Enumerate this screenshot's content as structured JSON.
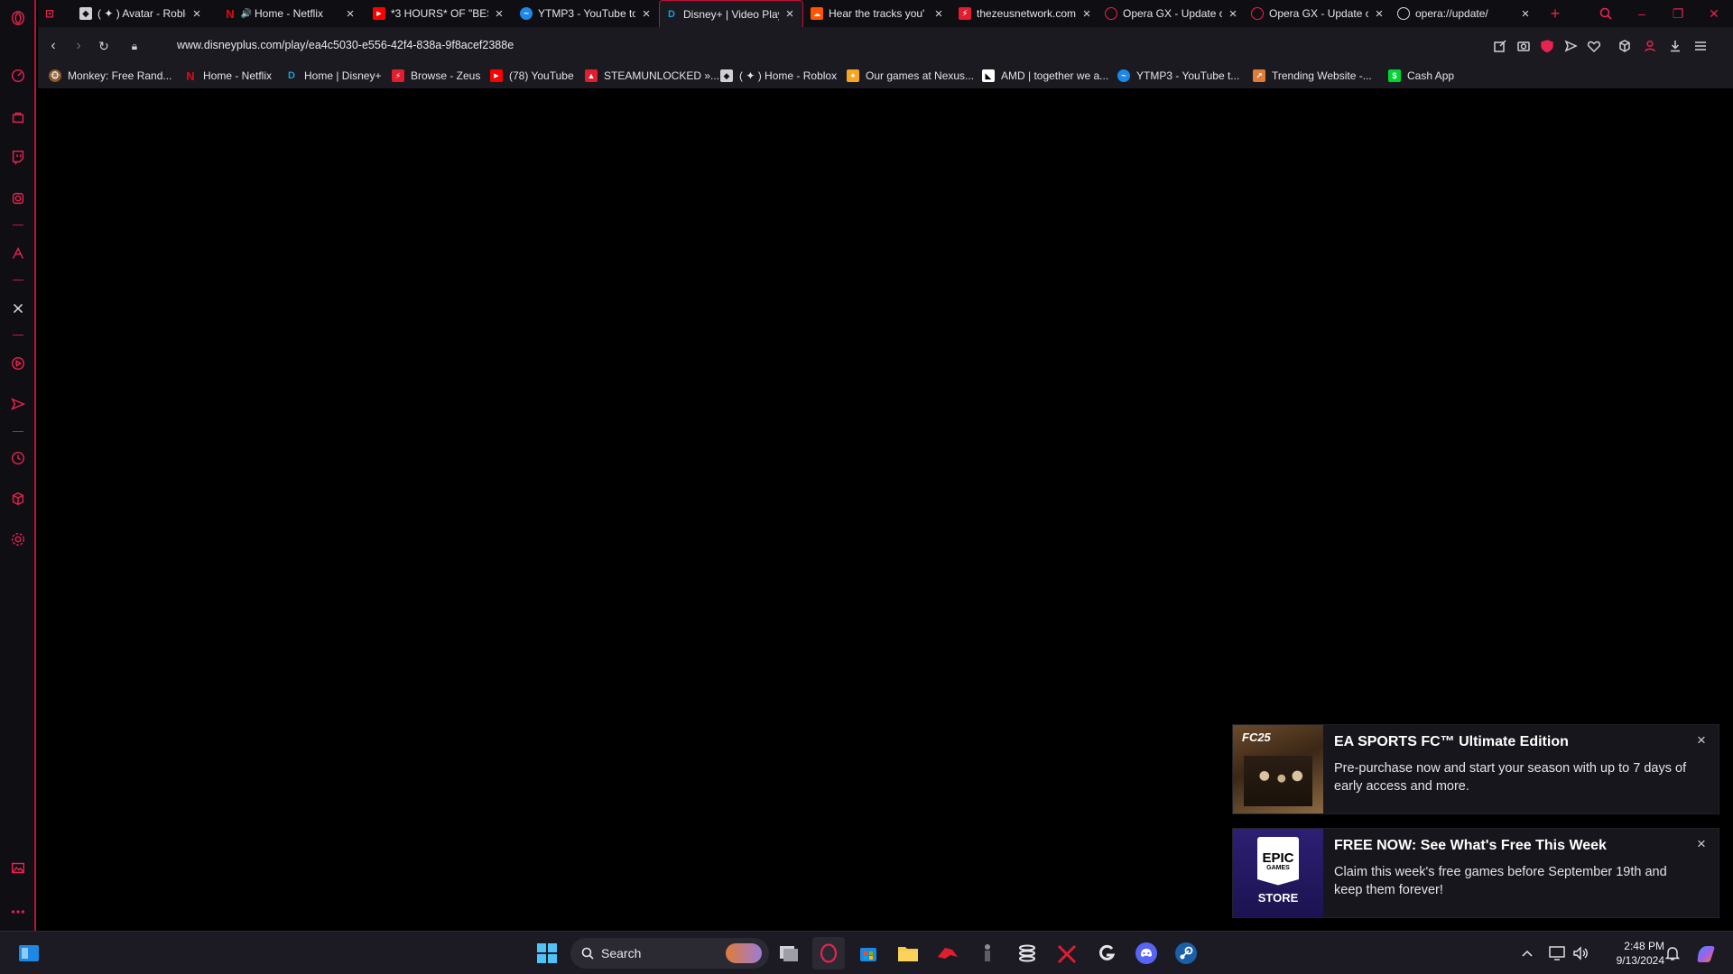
{
  "window": {
    "tabs": [
      {
        "title": "( ✦ ) Avatar - Roblox",
        "favicon": "roblox-icon",
        "color": "#cfcfd4",
        "active": false
      },
      {
        "title": "Home - Netflix",
        "favicon": "netflix-icon",
        "color": "#e50914",
        "active": false
      },
      {
        "title": "*3 HOURS* OF \"BEST",
        "favicon": "youtube-icon",
        "color": "#ff0000",
        "active": false
      },
      {
        "title": "YTMP3 - YouTube to",
        "favicon": "ytmp3-icon",
        "color": "#1e88e5",
        "active": false
      },
      {
        "title": "Disney+ | Video Play",
        "favicon": "disney-icon",
        "color": "#1a9fd6",
        "active": true
      },
      {
        "title": "Hear the tracks you'",
        "favicon": "soundcloud-icon",
        "color": "#ff5500",
        "active": false
      },
      {
        "title": "thezeusnetwork.com",
        "favicon": "zeus-icon",
        "color": "#e11d2e",
        "active": false
      },
      {
        "title": "Opera GX - Update c",
        "favicon": "opera-icon",
        "color": "#e8234f",
        "active": false
      },
      {
        "title": "Opera GX - Update c",
        "favicon": "opera-icon",
        "color": "#e8234f",
        "active": false
      },
      {
        "title": "opera://update/",
        "favicon": "opera-icon",
        "color": "#d8d8dc",
        "active": false
      }
    ]
  },
  "address_bar": {
    "url": "www.disneyplus.com/play/ea4c5030-e556-42f4-838a-9f8acef2388e"
  },
  "bookmarks": [
    {
      "label": "Monkey: Free Rand...",
      "icon": "monkey-icon",
      "color": "#f2b84b"
    },
    {
      "label": "Home - Netflix",
      "icon": "netflix-icon",
      "color": "#e50914"
    },
    {
      "label": "Home | Disney+",
      "icon": "disney-icon",
      "color": "#1a9fd6"
    },
    {
      "label": "Browse - Zeus",
      "icon": "zeus-icon",
      "color": "#e11d2e"
    },
    {
      "label": "(78) YouTube",
      "icon": "youtube-icon",
      "color": "#ff0000"
    },
    {
      "label": "STEAMUNLOCKED »...",
      "icon": "steamunlocked-icon",
      "color": "#e11d2e"
    },
    {
      "label": "( ✦ ) Home - Roblox",
      "icon": "roblox-icon",
      "color": "#cfcfd4"
    },
    {
      "label": "Our games at Nexus...",
      "icon": "nexus-icon",
      "color": "#f5a623"
    },
    {
      "label": "AMD | together we a...",
      "icon": "amd-icon",
      "color": "#ffffff"
    },
    {
      "label": "YTMP3 - YouTube t...",
      "icon": "ytmp3-icon",
      "color": "#1e88e5"
    },
    {
      "label": "Trending Website -...",
      "icon": "trending-icon",
      "color": "#e07b39"
    },
    {
      "label": "Cash App",
      "icon": "cashapp-icon",
      "color": "#00d632"
    }
  ],
  "notifications": [
    {
      "title": "EA SPORTS FC™ Ultimate Edition",
      "text": "Pre-purchase now and start your season with up to 7 days of early access and more.",
      "thumb_label": "FC25"
    },
    {
      "title": "FREE NOW: See What's Free This Week",
      "text": "Claim this week's free games before September 19th and keep them forever!",
      "thumb_label_top": "EPIC",
      "thumb_label_mid": "GAMES",
      "thumb_label_bottom": "STORE"
    }
  ],
  "taskbar": {
    "search_placeholder": "Search",
    "time": "2:48 PM",
    "date": "9/13/2024"
  },
  "accent_color": "#e8234f"
}
